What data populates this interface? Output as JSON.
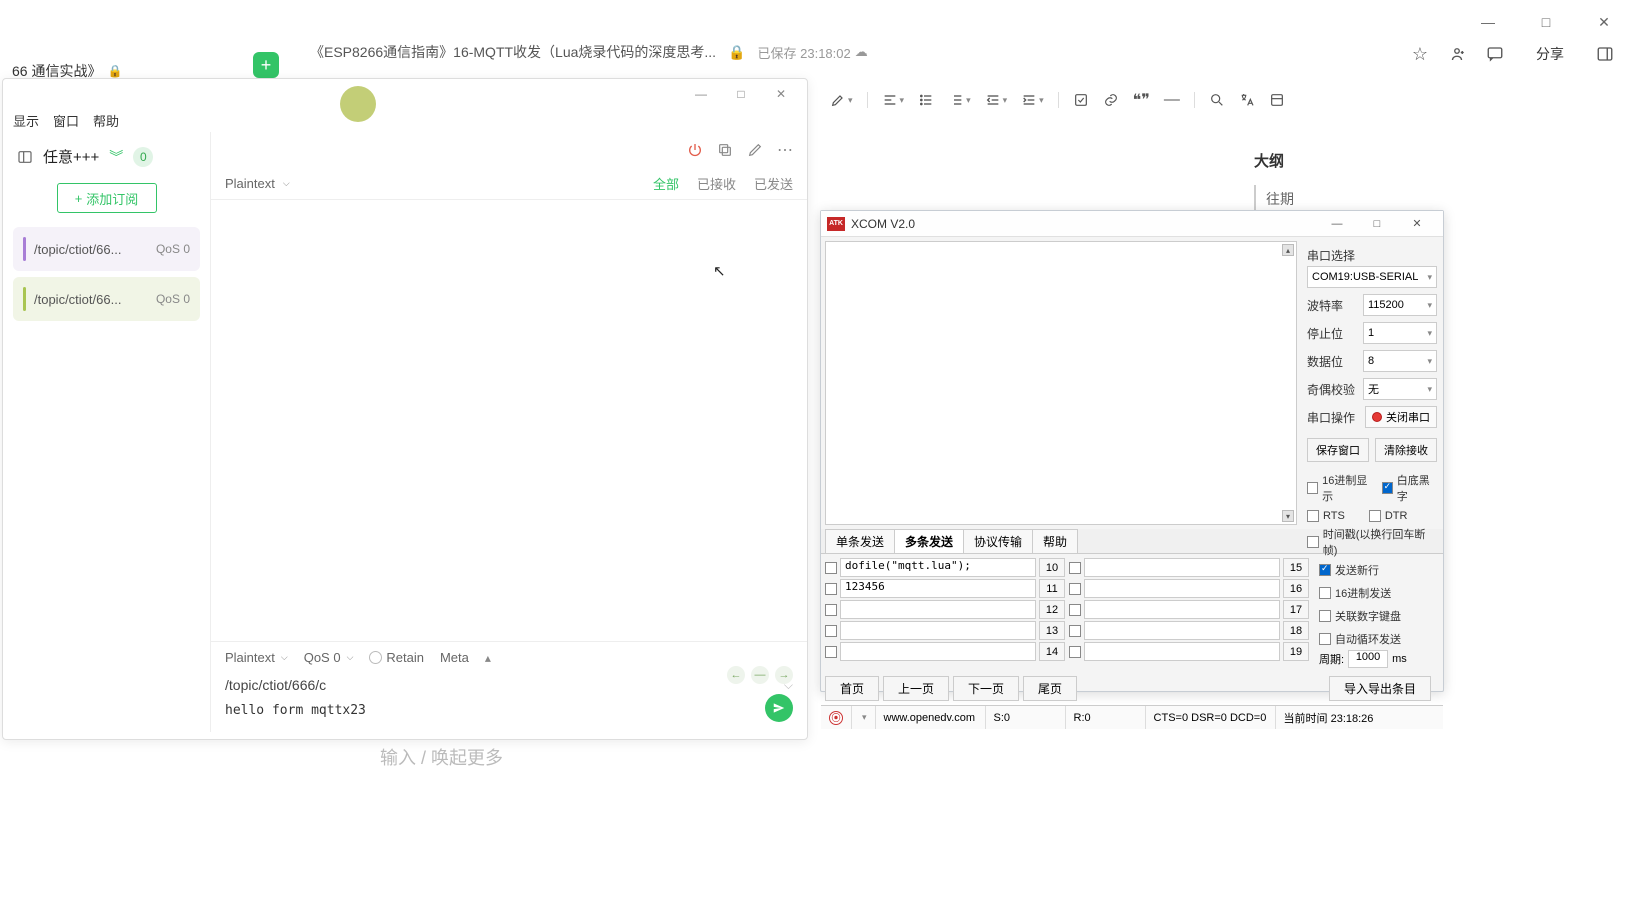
{
  "window": {
    "minimize": "—",
    "maximize": "□",
    "close": "✕"
  },
  "doc": {
    "tab1": "66 通信实战》",
    "title": "《ESP8266通信指南》16-MQTT收发（Lua烧录代码的深度思考...",
    "saved_label": "已保存 23:18:02",
    "share": "分享",
    "outline_title": "大纲",
    "outline_item1": "往期",
    "bottom_placeholder": "输入 / 唤起更多"
  },
  "mqtt": {
    "menu": {
      "display": "显示",
      "window": "窗口",
      "help": "帮助"
    },
    "conn_name": "任意+++",
    "badge": "0",
    "add_sub": "添加订阅",
    "topics": [
      {
        "path": "/topic/ctiot/66...",
        "qos": "QoS 0"
      },
      {
        "path": "/topic/ctiot/66...",
        "qos": "QoS 0"
      }
    ],
    "encoding": "Plaintext",
    "filters": {
      "all": "全部",
      "received": "已接收",
      "sent": "已发送"
    },
    "compose": {
      "encoding": "Plaintext",
      "qos": "QoS 0",
      "retain": "Retain",
      "meta": "Meta",
      "topic": "/topic/ctiot/666/c",
      "payload": "hello form mqttx23"
    }
  },
  "xcom": {
    "title": "XCOM V2.0",
    "side": {
      "port_label": "串口选择",
      "port_value": "COM19:USB-SERIAL",
      "baud_label": "波特率",
      "baud_value": "115200",
      "stop_label": "停止位",
      "stop_value": "1",
      "data_label": "数据位",
      "data_value": "8",
      "parity_label": "奇偶校验",
      "parity_value": "无",
      "op_label": "串口操作",
      "op_btn": "关闭串口",
      "save_win": "保存窗口",
      "clear_rx": "清除接收",
      "hex_display": "16进制显示",
      "white_bg": "白底黑字",
      "rts": "RTS",
      "dtr": "DTR",
      "timestamp": "时间戳(以换行回车断帧)"
    },
    "tabs": {
      "single": "单条发送",
      "multi": "多条发送",
      "proto": "协议传输",
      "help": "帮助"
    },
    "rows": {
      "r10": "dofile(\"mqtt.lua\");",
      "r11": "123456",
      "r12": "",
      "r13": "",
      "r14": "",
      "r15": "",
      "r16": "",
      "r17": "",
      "r18": "",
      "r19": ""
    },
    "nums": {
      "n10": "10",
      "n11": "11",
      "n12": "12",
      "n13": "13",
      "n14": "14",
      "n15": "15",
      "n16": "16",
      "n17": "17",
      "n18": "18",
      "n19": "19"
    },
    "opts": {
      "send_newline": "发送新行",
      "hex_send": "16进制发送",
      "numpad": "关联数字键盘",
      "auto_loop": "自动循环发送",
      "period_label": "周期:",
      "period_value": "1000",
      "period_unit": "ms"
    },
    "nav": {
      "first": "首页",
      "prev": "上一页",
      "next": "下一页",
      "last": "尾页",
      "export": "导入导出条目"
    },
    "status": {
      "url": "www.openedv.com",
      "s": "S:0",
      "r": "R:0",
      "cts": "CTS=0 DSR=0 DCD=0",
      "time": "当前时间 23:18:26"
    }
  }
}
